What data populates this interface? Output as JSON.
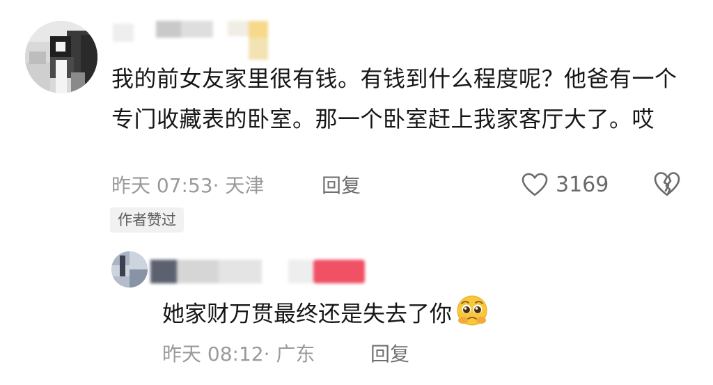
{
  "comment": {
    "text": "我的前女友家里很有钱。有钱到什么程度呢？他爸有一个专门收藏表的卧室。那一个卧室赶上我家客厅大了。哎",
    "time_location": "昨天 07:53· 天津",
    "reply_label": "回复",
    "like_count": "3169",
    "author_badge": "作者赞过",
    "icons": [
      "heart-outline-icon",
      "broken-heart-icon"
    ]
  },
  "reply": {
    "text": "她家财万贯最终还是失去了你",
    "emoji": "pleading-face-emoji",
    "time_location": "昨天 08:12· 广东",
    "reply_label": "回复"
  }
}
